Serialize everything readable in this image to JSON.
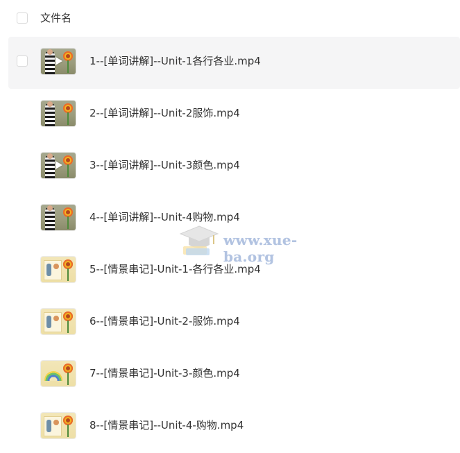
{
  "header": {
    "column_label": "文件名"
  },
  "files": [
    {
      "name": "1--[单词讲解]--Unit-1各行各业.mp4",
      "thumb": "word-video-thumbnail",
      "selected": true
    },
    {
      "name": "2--[单词讲解]--Unit-2服饰.mp4",
      "thumb": "word-video-thumbnail",
      "selected": false
    },
    {
      "name": "3--[单词讲解]--Unit-3颜色.mp4",
      "thumb": "word-video-thumbnail",
      "selected": false
    },
    {
      "name": "4--[单词讲解]--Unit-4购物.mp4",
      "thumb": "word-video-thumbnail",
      "selected": false
    },
    {
      "name": "5--[情景串记]-Unit-1-各行各业.mp4",
      "thumb": "scene-video-thumbnail",
      "selected": false
    },
    {
      "name": "6--[情景串记]-Unit-2-服饰.mp4",
      "thumb": "scene-video-thumbnail",
      "selected": false
    },
    {
      "name": "7--[情景串记]-Unit-3-颜色.mp4",
      "thumb": "scene-video-thumbnail",
      "selected": false
    },
    {
      "name": "8--[情景串记]--Unit-4-购物.mp4",
      "thumb": "scene-video-thumbnail",
      "selected": false
    }
  ],
  "watermark": {
    "text": "www.xue-ba.org",
    "icon": "graduation-cap-icon"
  },
  "colors": {
    "selected_row_bg": "#f5f5f6",
    "text": "#333333",
    "checkbox_border": "#d9d9d9",
    "watermark_text": "#8aa4d2"
  }
}
